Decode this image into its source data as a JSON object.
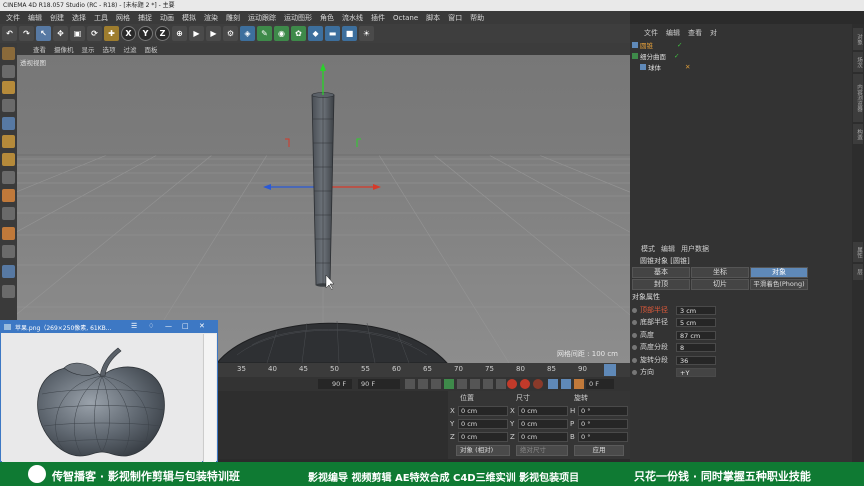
{
  "window": {
    "title": "CINEMA 4D R18.057 Studio (RC - R18) - [未标题 2 *] - 主要"
  },
  "menu": [
    "文件",
    "编辑",
    "创建",
    "选择",
    "工具",
    "网格",
    "捕捉",
    "动画",
    "模拟",
    "渲染",
    "雕刻",
    "运动跟踪",
    "运动图形",
    "角色",
    "流水线",
    "插件",
    "Octane",
    "脚本",
    "窗口",
    "帮助"
  ],
  "toolbar": {
    "axis_x": "X",
    "axis_y": "Y",
    "axis_z": "Z"
  },
  "viewport": {
    "menu": [
      "查看",
      "摄像机",
      "显示",
      "选项",
      "过滤",
      "面板"
    ],
    "label": "透视视图",
    "grid_info": "网格间距 : 100 cm"
  },
  "timeline": {
    "ticks": [
      "35",
      "40",
      "45",
      "50",
      "55",
      "60",
      "65",
      "70",
      "75",
      "80",
      "85",
      "90"
    ],
    "frame_a": "90 F",
    "frame_b": "90 F",
    "frame_c": "0 F"
  },
  "coordinates": {
    "headers": [
      "位置",
      "尺寸",
      "旋转"
    ],
    "rows": [
      {
        "axis": "X",
        "pos": "0 cm",
        "size": "0 cm",
        "rot_axis": "H",
        "rot": "0 °"
      },
      {
        "axis": "Y",
        "pos": "0 cm",
        "size": "0 cm",
        "rot_axis": "P",
        "rot": "0 °"
      },
      {
        "axis": "Z",
        "pos": "0 cm",
        "size": "0 cm",
        "rot_axis": "B",
        "rot": "0 °"
      }
    ],
    "mode_select": "对象 (相对)",
    "size_select": "绝对尺寸",
    "apply": "应用"
  },
  "objects": {
    "menu": [
      "文件",
      "编辑",
      "查看",
      "对"
    ],
    "items": [
      {
        "name": "圆锥",
        "selected": true
      },
      {
        "name": "细分曲面",
        "selected": false
      },
      {
        "name": "球体",
        "selected": false
      }
    ]
  },
  "attributes": {
    "menu": [
      "模式",
      "编辑",
      "用户数据"
    ],
    "title": "圆锥对象 [圆锥]",
    "tabs_row1": [
      "基本",
      "坐标",
      "对象"
    ],
    "tabs_row2": [
      "封顶",
      "切片",
      "平滑着色(Phong)"
    ],
    "section": "对象属性",
    "fields": [
      {
        "label": "顶部半径",
        "value": "3 cm",
        "highlight": true
      },
      {
        "label": "底部半径",
        "value": "5 cm",
        "highlight": false
      },
      {
        "label": "高度",
        "value": "87 cm",
        "highlight": false
      },
      {
        "label": "高度分段",
        "value": "8",
        "highlight": false
      },
      {
        "label": "旋转分段",
        "value": "36",
        "highlight": false
      },
      {
        "label": "方向",
        "value": "+Y",
        "highlight": false
      }
    ]
  },
  "popup": {
    "title": "苹果.png（269×250像素, 61KB..."
  },
  "right_tabs": [
    "对象",
    "场次",
    "内容浏览器",
    "构造",
    "属性",
    "层"
  ],
  "banner": {
    "left": "传智播客 · 影视制作剪辑与包装特训班",
    "middle": "影视编导  视频剪辑  AE特效合成  C4D三维实训  影视包装项目",
    "right": "只花一份钱 · 同时掌握五种职业技能"
  },
  "colors": {
    "accent": "#5f89b8",
    "banner": "#0f7a33",
    "popup_border": "#3d78c4",
    "highlight": "#e05a3a"
  }
}
